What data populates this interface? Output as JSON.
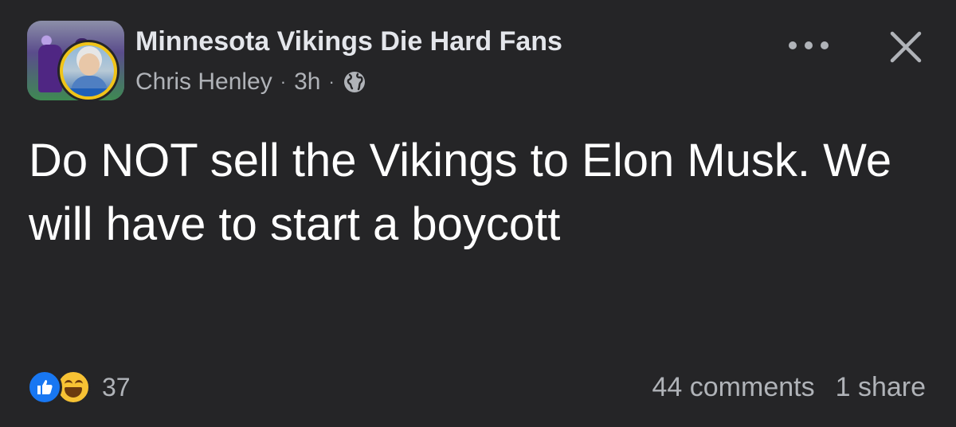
{
  "group": {
    "name": "Minnesota Vikings Die Hard Fans"
  },
  "author": {
    "name": "Chris Henley",
    "time": "3h",
    "separator": "·",
    "audience_icon": "globe-icon"
  },
  "post": {
    "text": "Do NOT sell the Vikings to Elon Musk. We will have to start a boycott"
  },
  "reactions": {
    "icons": [
      "like-icon",
      "haha-icon"
    ],
    "count": "37"
  },
  "footer": {
    "comments": "44 comments",
    "shares": "1 share"
  },
  "colors": {
    "background": "#252527",
    "text_primary": "#e4e6eb",
    "text_secondary": "#b0b3b8",
    "like_blue": "#1877f2",
    "haha_yellow": "#f7c234"
  }
}
